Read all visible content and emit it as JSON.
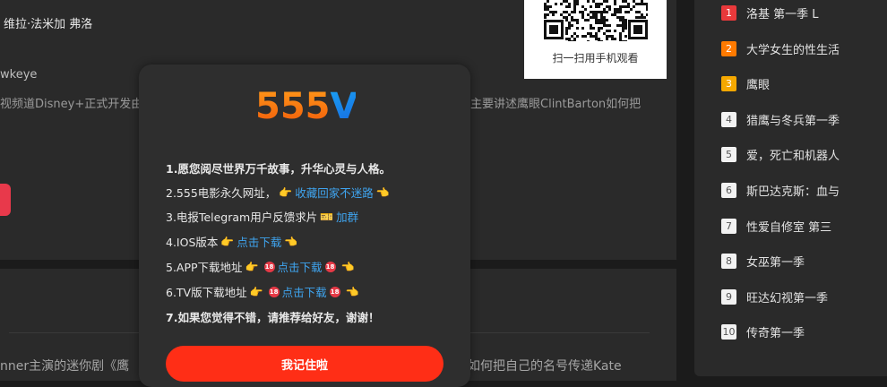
{
  "detail": {
    "cast_fragment": "维拉·法米加 弗洛",
    "title_fragment": "wkeye",
    "description_left": "视频道Disney+正式开发由",
    "description_right": "主要讲述鹰眼ClintBarton如何把"
  },
  "second": {
    "description_left": "nner主演的迷你剧《鹰",
    "description_right": "如何把自己的名号传递Kate"
  },
  "qr": {
    "caption": "扫一扫用手机观看"
  },
  "ranking": {
    "items": [
      {
        "rank": "1",
        "title": "洛基 第一季 L"
      },
      {
        "rank": "2",
        "title": "大学女生的性生活"
      },
      {
        "rank": "3",
        "title": "鹰眼"
      },
      {
        "rank": "4",
        "title": "猎鹰与冬兵第一季"
      },
      {
        "rank": "5",
        "title": "爱，死亡和机器人"
      },
      {
        "rank": "6",
        "title": "斯巴达克斯：血与"
      },
      {
        "rank": "7",
        "title": "性爱自修室 第三"
      },
      {
        "rank": "8",
        "title": "女巫第一季"
      },
      {
        "rank": "9",
        "title": "旺达幻视第一季"
      },
      {
        "rank": "10",
        "title": "传奇第一季"
      }
    ]
  },
  "modal": {
    "logo_text": "555V",
    "line1": "1.愿您阅尽世界万千故事，升华心灵与人格。",
    "line2_text": "2.555电影永久网址，",
    "line2_link": "收藏回家不迷路",
    "line3_text": "3.电报Telegram用户反馈求片",
    "line3_link": "加群",
    "line4_text": "4.IOS版本",
    "line4_link": "点击下载",
    "line5_text": "5.APP下载地址",
    "line5_link": "点击下载",
    "line6_text": "6.TV版下载地址",
    "line6_link": "点击下载",
    "line7": "7.如果您觉得不错，请推荐给好友，谢谢！",
    "confirm_label": "我记住啦",
    "emoji": {
      "hand": "👉",
      "hand_back": "👈",
      "ticket": "🎫",
      "noentry": "🔞"
    }
  },
  "colors": {
    "accent_red": "#ff2e16",
    "link_blue": "#3fa4ef",
    "rank1": "#e8393b",
    "rank2": "#ff7a00",
    "rank3": "#f5a800"
  }
}
